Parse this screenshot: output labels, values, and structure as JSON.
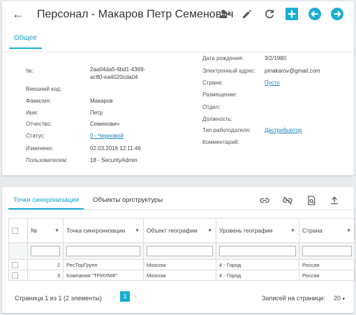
{
  "header": {
    "title": "Персонал - Макаров Петр Семенович",
    "tab_general": "Общее"
  },
  "icons": {
    "back": "arrow-left-icon",
    "approve": "user-check-icon",
    "edit": "pencil-icon",
    "refresh": "refresh-icon",
    "add": "plus-icon",
    "prev_record": "circle-arrow-left-icon",
    "next_record": "circle-arrow-right-icon",
    "link": "link-icon",
    "unlink": "link-off-icon",
    "find": "document-search-icon",
    "export": "upload-icon"
  },
  "colors": {
    "accent": "#1aaed2",
    "link": "#1a7fbf"
  },
  "fields_left": [
    {
      "label": "№:",
      "value": "2aa04da5-6bd1-4369-",
      "value2": "ac80-ea4020cda04"
    },
    {
      "label": "Внешний код:",
      "value": ""
    },
    {
      "label": "Фамилия:",
      "value": "Макаров"
    },
    {
      "label": "Имя:",
      "value": "Петр"
    },
    {
      "label": "Отчество:",
      "value": "Семенович"
    },
    {
      "label": "Статус:",
      "value": "0 - Черновой"
    },
    {
      "label": "Изменено:",
      "value": "02.03.2016 12:11:46"
    },
    {
      "label": "Пользователем:",
      "value": "18 - SecurityAdmin"
    }
  ],
  "fields_right": [
    {
      "label": "Дата рождения:",
      "value": "3/2/1980"
    },
    {
      "label": "Электронный адрес:",
      "value": "pmakarov@gmail.com"
    },
    {
      "label": "Страна:",
      "value": "Пусто"
    },
    {
      "label": "Размещение:",
      "value": ""
    },
    {
      "label": "Отдел:",
      "value": ""
    },
    {
      "label": "Должность:",
      "value": ""
    },
    {
      "label": "Тип работодателя:",
      "value": "Дистрибьютор"
    },
    {
      "label": "Комментарий:",
      "value": ""
    }
  ],
  "bottom_tabs": {
    "sync_points": "Точки синхронизации",
    "org_objects": "Объекты оргструктуры"
  },
  "table": {
    "columns": [
      "№",
      "Точка синхронизации",
      "Объект географии",
      "Уровень географии",
      "Страна"
    ],
    "rows": [
      {
        "num": "2",
        "point": "РесТорГрупп",
        "geo": "Moscow",
        "level": "4 - Город",
        "country": "Россия"
      },
      {
        "num": "3",
        "point": "Компания \"ТРИУМФ\"",
        "geo": "Moscow",
        "level": "4 - Город",
        "country": "Россия"
      }
    ]
  },
  "pager": {
    "text": "Страница 1 из 1 (2 элементы)",
    "current": "1",
    "prev": "‹",
    "next": "›",
    "per_page_label": "Записей на странице:",
    "per_page_value": "20"
  }
}
